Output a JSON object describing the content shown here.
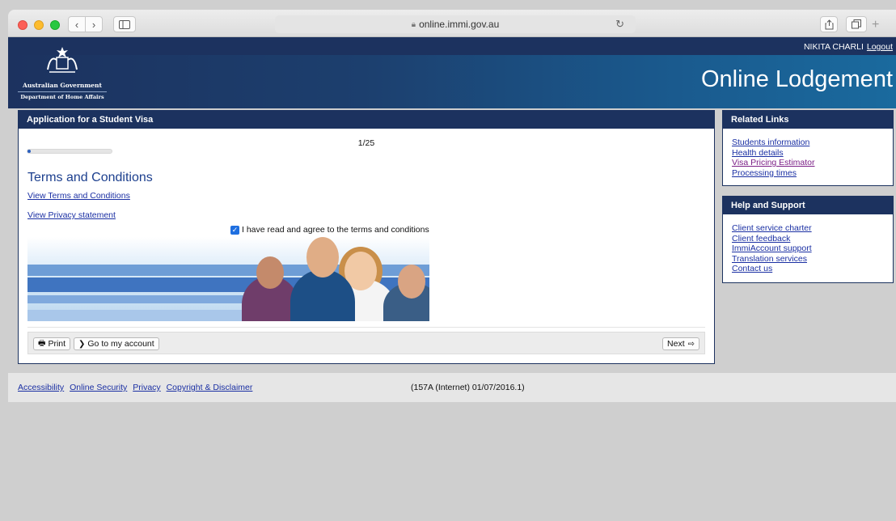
{
  "browser": {
    "url": "online.immi.gov.au"
  },
  "header": {
    "user_name": "NIKITA CHARLI",
    "logout_label": "Logout",
    "logo_line1": "Australian Government",
    "logo_line2": "Department of Home Affairs",
    "site_title": "Online Lodgement"
  },
  "main": {
    "panel_title": "Application for a Student Visa",
    "step_counter": "1/25",
    "progress_fraction": 0.04,
    "section_title": "Terms and Conditions",
    "view_terms_link": "View Terms and Conditions",
    "view_privacy_link": "View Privacy statement",
    "agree_label": "I have read and agree to the terms and conditions",
    "agree_checked": true,
    "buttons": {
      "print": "Print",
      "go_account": "Go to my account",
      "next": "Next"
    }
  },
  "related_links": {
    "title": "Related Links",
    "items": [
      {
        "label": "Students information",
        "visited": false
      },
      {
        "label": "Health details",
        "visited": false
      },
      {
        "label": "Visa Pricing Estimator",
        "visited": true
      },
      {
        "label": "Processing times",
        "visited": false
      }
    ]
  },
  "help_support": {
    "title": "Help and Support",
    "items": [
      {
        "label": "Client service charter"
      },
      {
        "label": "Client feedback"
      },
      {
        "label": "ImmiAccount support"
      },
      {
        "label": "Translation services"
      },
      {
        "label": "Contact us"
      }
    ]
  },
  "footer": {
    "links": [
      "Accessibility",
      "Online Security",
      "Privacy",
      "Copyright & Disclaimer"
    ],
    "version": "(157A (Internet) 01/07/2016.1)"
  },
  "colors": {
    "brand_navy": "#1c325f",
    "link_blue": "#1a2fa3",
    "visited_purple": "#7b1f86",
    "checkbox_blue": "#1f6fe0"
  }
}
